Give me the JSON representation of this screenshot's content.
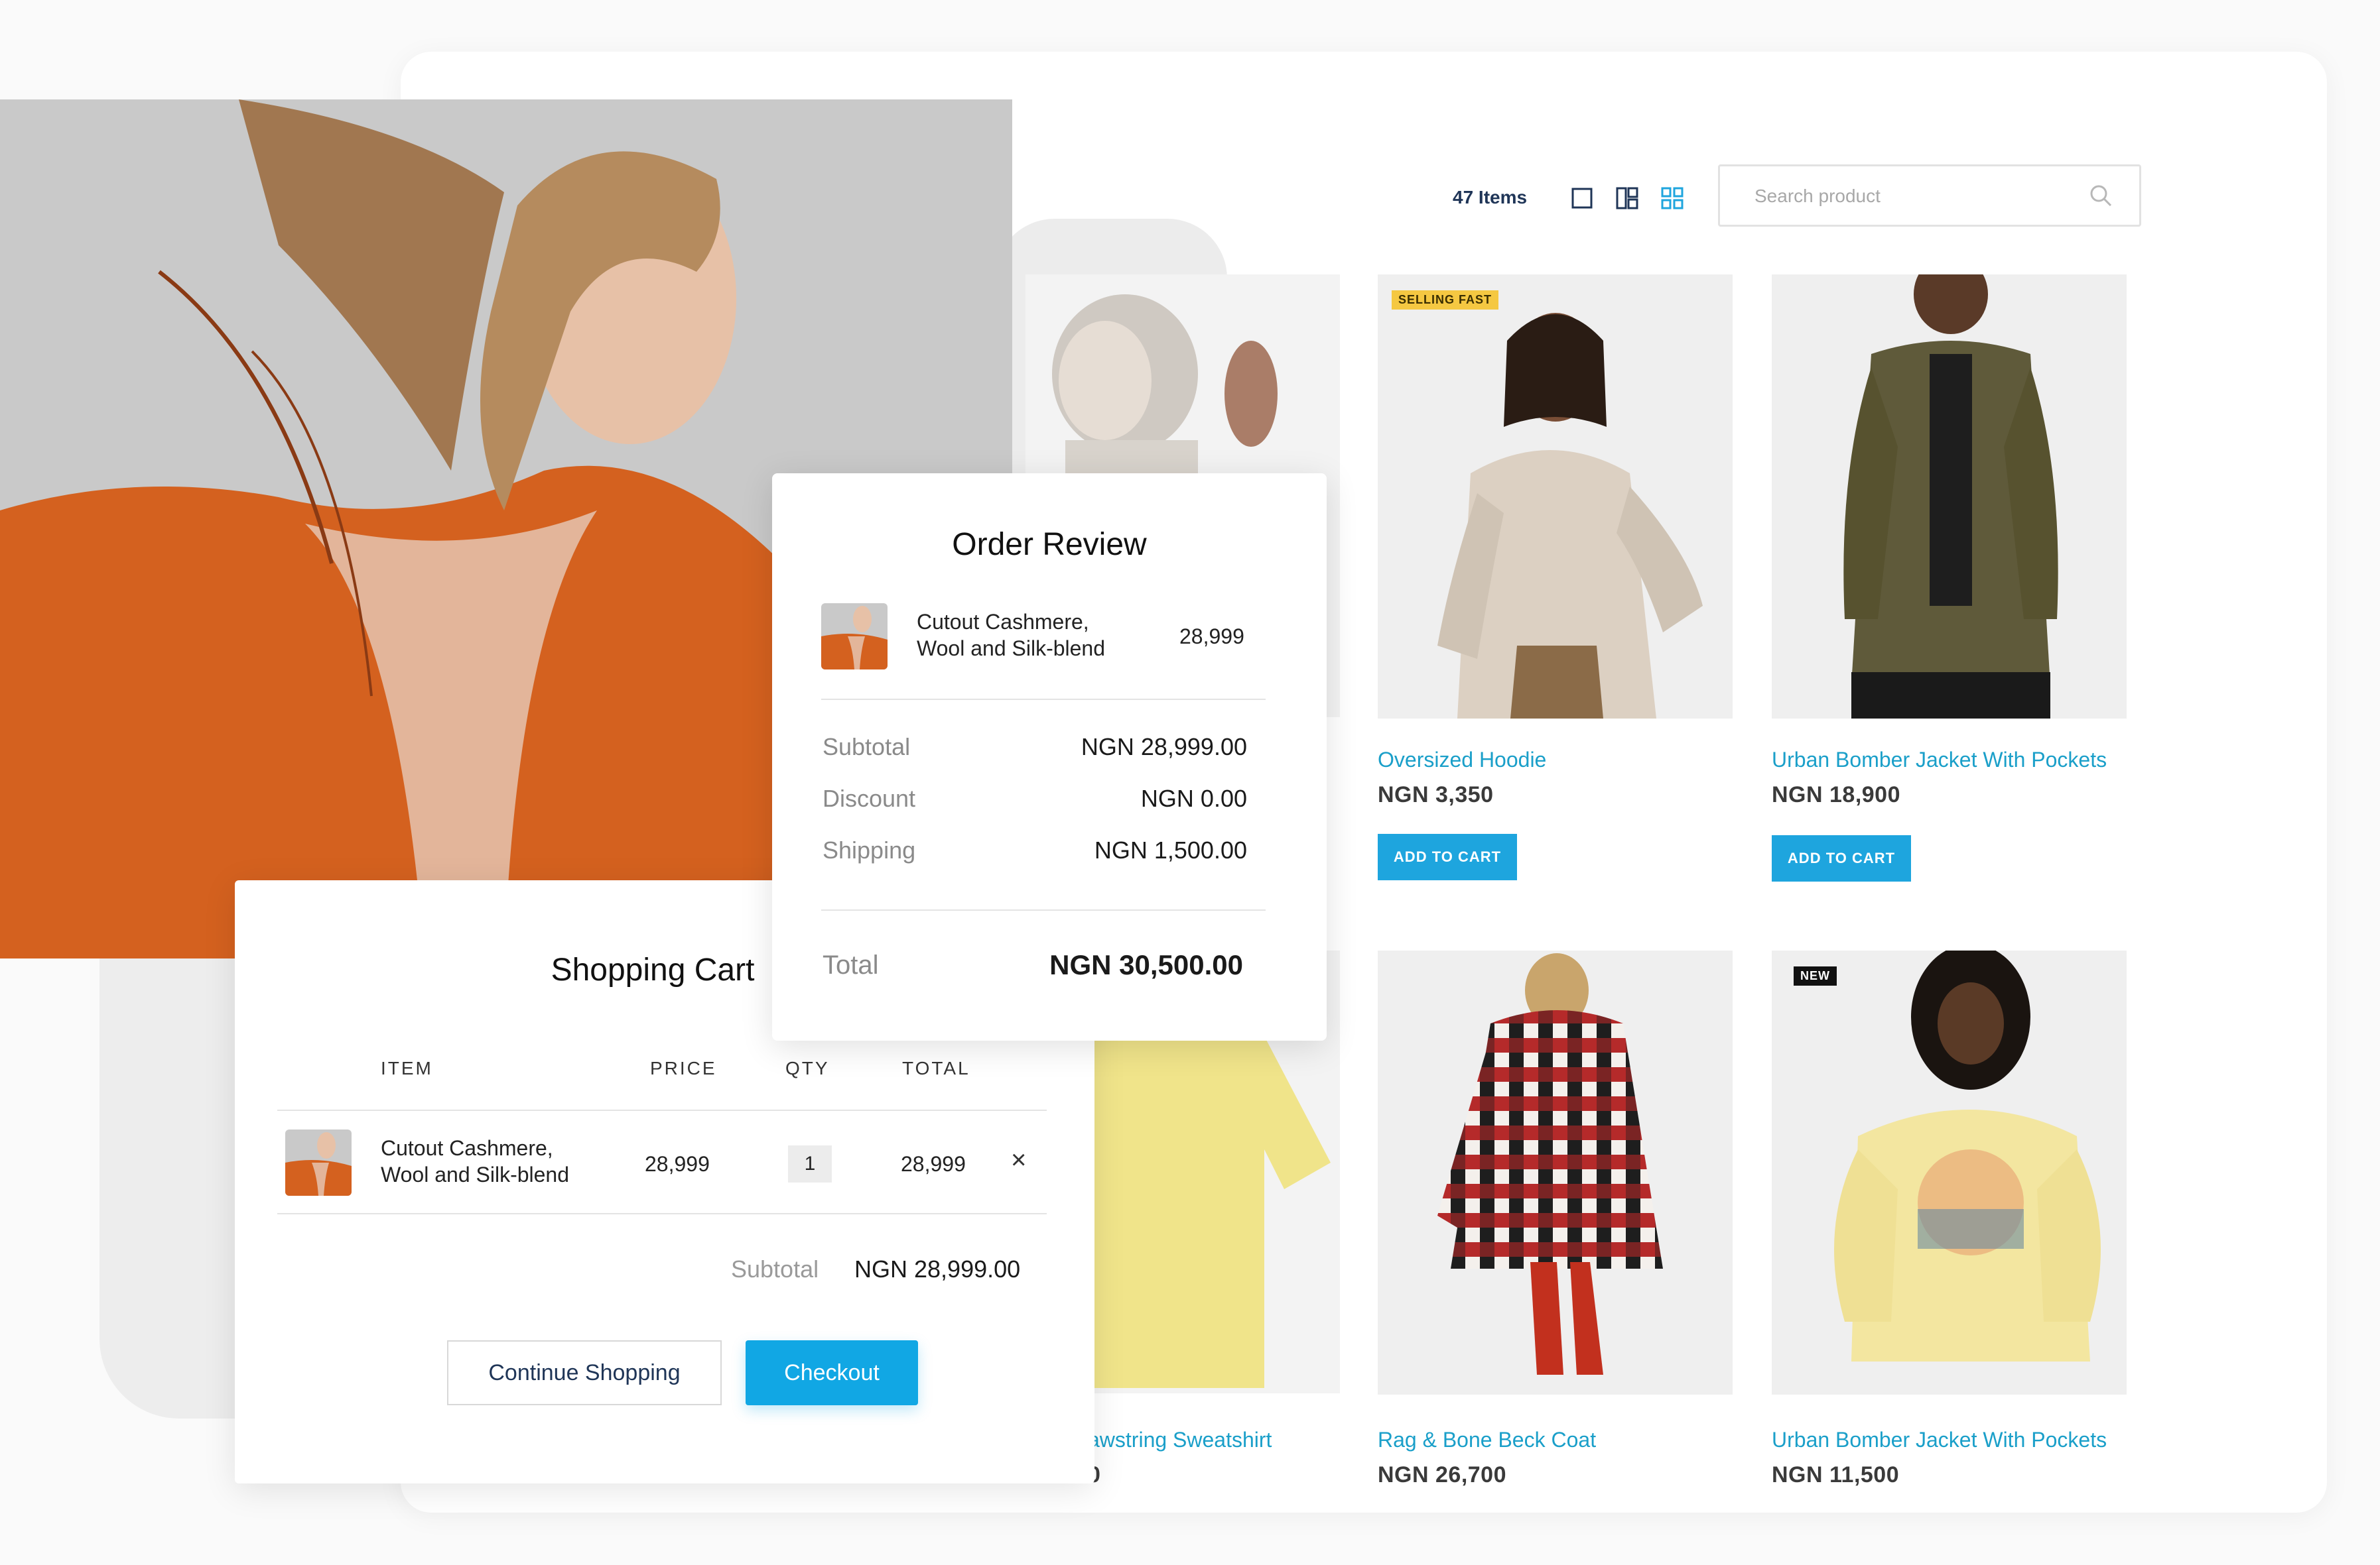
{
  "toolbar": {
    "items_count": "47 Items",
    "search_placeholder": "Search product"
  },
  "products": [
    {
      "name": "Oversized Hoodie",
      "price": "NGN 3,350",
      "badge": "SELLING FAST",
      "button": "ADD TO CART"
    },
    {
      "name": "Urban Bomber Jacket With Pockets",
      "price": "NGN 18,900",
      "badge": "",
      "button": "ADD TO CART"
    },
    {
      "name": "awstring Sweatshirt",
      "price": "0",
      "badge": ""
    },
    {
      "name": "Rag & Bone Beck Coat",
      "price": "NGN 26,700",
      "badge": ""
    },
    {
      "name": "Urban Bomber Jacket With Pockets",
      "price": "NGN 11,500",
      "badge": "NEW"
    }
  ],
  "cart": {
    "title": "Shopping Cart",
    "headers": {
      "item": "ITEM",
      "price": "PRICE",
      "qty": "QTY",
      "total": "TOTAL"
    },
    "row": {
      "name_line1": "Cutout Cashmere,",
      "name_line2": "Wool and Silk-blend",
      "price": "28,999",
      "qty": "1",
      "total": "28,999"
    },
    "remove_glyph": "×",
    "subtotal_label": "Subtotal",
    "subtotal_value": "NGN 28,999.00",
    "continue_label": "Continue Shopping",
    "checkout_label": "Checkout"
  },
  "order": {
    "title": "Order Review",
    "item_line1": "Cutout Cashmere,",
    "item_line2": "Wool and Silk-blend",
    "item_price": "28,999",
    "subtotal_label": "Subtotal",
    "subtotal_value": "NGN 28,999.00",
    "discount_label": "Discount",
    "discount_value": "NGN 0.00",
    "shipping_label": "Shipping",
    "shipping_value": "NGN 1,500.00",
    "total_label": "Total",
    "total_value": "NGN 30,500.00"
  },
  "colors": {
    "accent": "#11a7e4",
    "product_link": "#1a9fc9",
    "badge_selling": "#f5c842",
    "badge_new": "#111111"
  }
}
